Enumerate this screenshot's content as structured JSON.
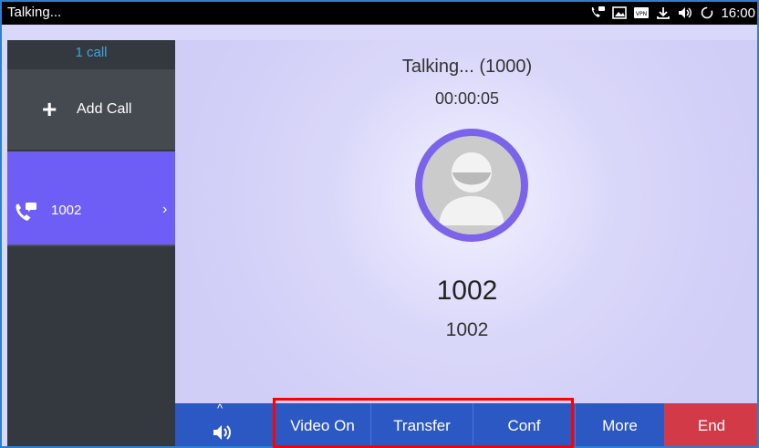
{
  "status_bar": {
    "title": "Talking...",
    "time": "16:00",
    "icons": [
      "call-icon",
      "image-icon",
      "vpn-icon",
      "download-icon",
      "volume-icon",
      "sync-icon"
    ]
  },
  "sidebar": {
    "calls_count": "1 call",
    "add_call_label": "Add Call",
    "items": [
      {
        "label": "1002",
        "icon": "call-icon",
        "selected": true
      }
    ]
  },
  "call": {
    "status": "Talking... (1000)",
    "duration": "00:00:05",
    "name": "1002",
    "number": "1002"
  },
  "toolbar": {
    "audio_icon": "speaker-icon",
    "buttons": [
      {
        "label": "Video On"
      },
      {
        "label": "Transfer"
      },
      {
        "label": "Conf"
      },
      {
        "label": "More"
      },
      {
        "label": "End"
      }
    ]
  },
  "colors": {
    "accent": "#6f5ef5",
    "toolbar_blue": "#2c58c4",
    "end_red": "#d33a48",
    "highlight": "#ff0000"
  }
}
